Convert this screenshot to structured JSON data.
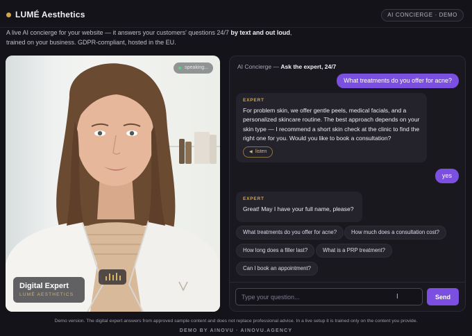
{
  "header": {
    "brand": "LUMÉ Aesthetics",
    "badge": "AI CONCIERGE · DEMO",
    "intro_part1": "A live AI concierge for your website — it answers your customers' questions 24/7 ",
    "intro_bold": "by text and out loud",
    "intro_part2": ", trained on your business. GDPR-compliant, hosted in the EU."
  },
  "video": {
    "status": "speaking...",
    "name_title": "Digital Expert",
    "name_subtitle": "LUMÉ AESTHETICS",
    "status_dot_color": "#5bd37a"
  },
  "chat": {
    "head_prefix": "AI Concierge — ",
    "head_bold": "Ask the expert, 24/7",
    "messages": [
      {
        "role": "user",
        "text": "What treatments do you offer for acne?"
      },
      {
        "role": "expert",
        "tag": "EXPERT",
        "text": "For problem skin, we offer gentle peels, medical facials, and a personalized skincare routine. The best approach depends on your skin type — I recommend a short skin check at the clinic to find the right one for you. Would you like to book a consultation?",
        "listen": "listen"
      },
      {
        "role": "user",
        "text": "yes"
      },
      {
        "role": "expert",
        "tag": "EXPERT",
        "text": "Great! May I have your full name, please?"
      }
    ],
    "suggestions": [
      "What treatments do you offer for acne?",
      "How much does a consultation cost?",
      "How long does a filler last?",
      "What is a PRP treatment?",
      "Can I book an appointment?"
    ],
    "input_placeholder": "Type your question...",
    "send_label": "Send",
    "accent_color": "#7b4fe0",
    "gold_color": "#d3a54a"
  },
  "footer": {
    "disclaimer": "Demo version. The digital expert answers from approved sample content and does not replace professional advice. In a live setup it is trained only on the content you provide.",
    "credit": "DEMO BY AINOVU · AINOVU.AGENCY"
  }
}
